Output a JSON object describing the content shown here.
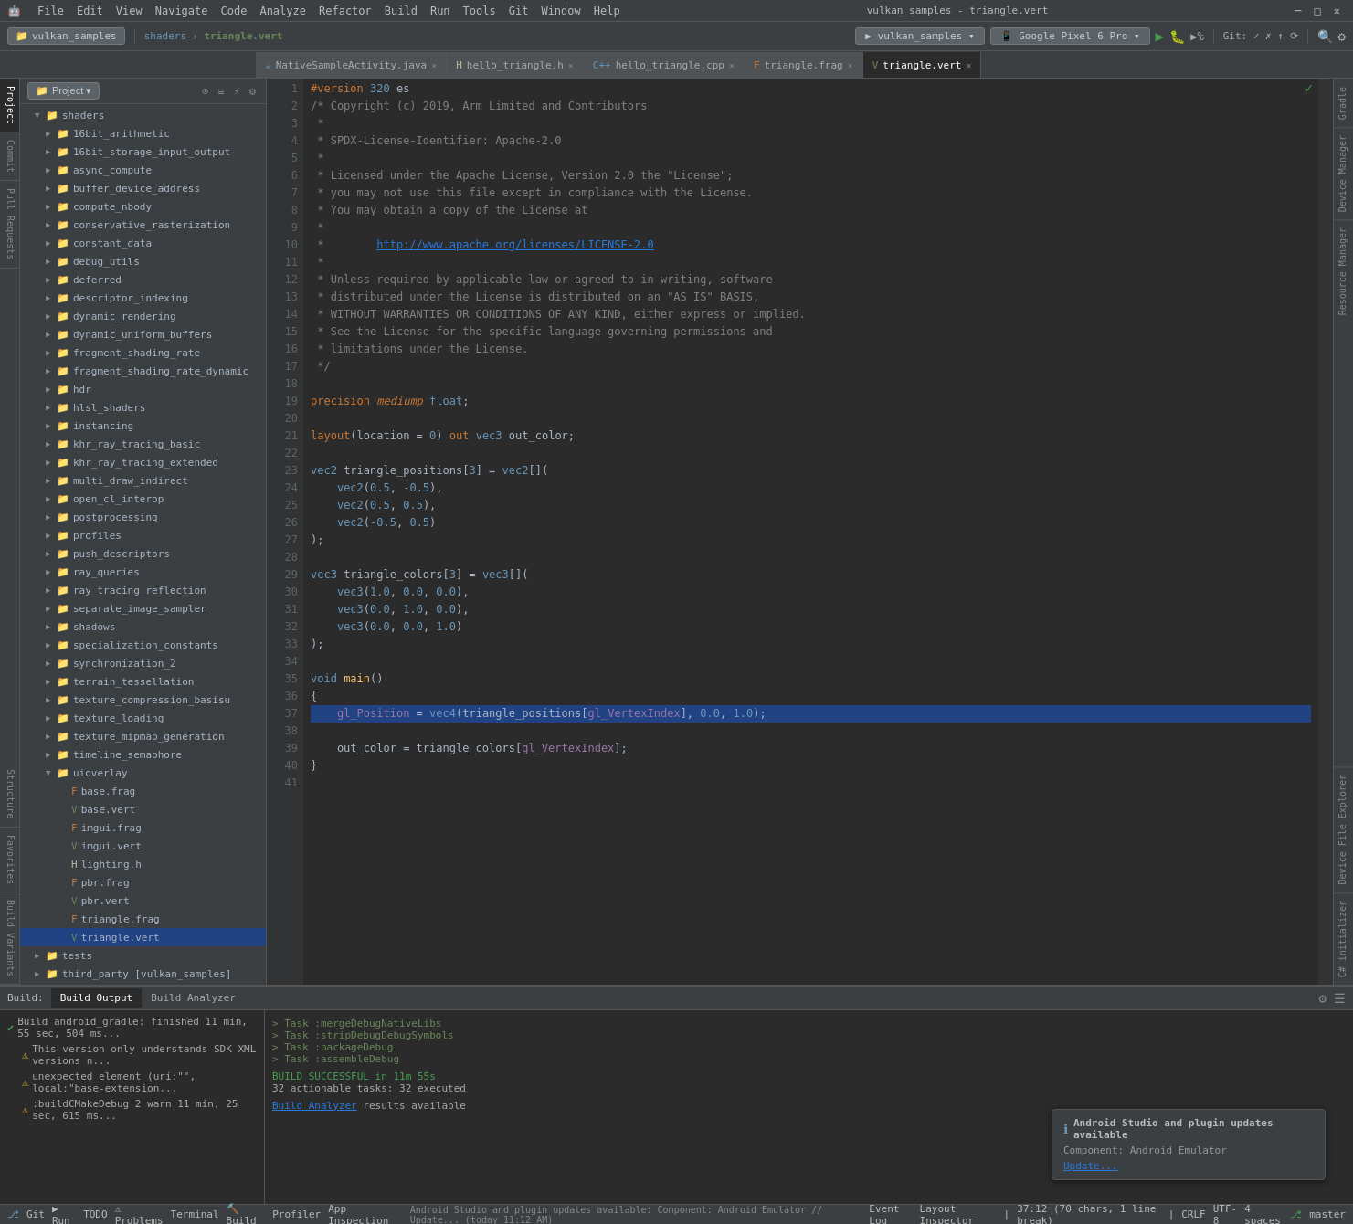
{
  "app": {
    "title": "vulkan_samples - triangle.vert",
    "window_controls": [
      "minimize",
      "maximize",
      "close"
    ]
  },
  "menu": {
    "items": [
      "File",
      "Edit",
      "View",
      "Navigate",
      "Code",
      "Analyze",
      "Refactor",
      "Build",
      "Run",
      "Tools",
      "Git",
      "Window",
      "Help"
    ]
  },
  "toolbar": {
    "project_name": "vulkan_samples",
    "device_name": "Google Pixel 6 Pro",
    "run_config": "vulkan_samples"
  },
  "tabs": [
    {
      "label": "NativeSampleActivity.java",
      "type": "java",
      "active": false
    },
    {
      "label": "hello_triangle.h",
      "type": "h",
      "active": false
    },
    {
      "label": "hello_triangle.cpp",
      "type": "cpp",
      "active": false
    },
    {
      "label": "triangle.frag",
      "type": "frag",
      "active": false
    },
    {
      "label": "triangle.vert",
      "type": "vert",
      "active": true
    }
  ],
  "project_panel": {
    "title": "Project",
    "header_btn": "Project ▾",
    "tree": [
      {
        "label": "shaders",
        "type": "folder",
        "depth": 1,
        "expanded": true
      },
      {
        "label": "16bit_arithmetic",
        "type": "folder",
        "depth": 2
      },
      {
        "label": "16bit_storage_input_output",
        "type": "folder",
        "depth": 2
      },
      {
        "label": "async_compute",
        "type": "folder",
        "depth": 2
      },
      {
        "label": "buffer_device_address",
        "type": "folder",
        "depth": 2
      },
      {
        "label": "compute_nbody",
        "type": "folder",
        "depth": 2
      },
      {
        "label": "conservative_rasterization",
        "type": "folder",
        "depth": 2
      },
      {
        "label": "constant_data",
        "type": "folder",
        "depth": 2
      },
      {
        "label": "debug_utils",
        "type": "folder",
        "depth": 2
      },
      {
        "label": "deferred",
        "type": "folder",
        "depth": 2
      },
      {
        "label": "descriptor_indexing",
        "type": "folder",
        "depth": 2
      },
      {
        "label": "dynamic_rendering",
        "type": "folder",
        "depth": 2
      },
      {
        "label": "dynamic_uniform_buffers",
        "type": "folder",
        "depth": 2
      },
      {
        "label": "fragment_shading_rate",
        "type": "folder",
        "depth": 2
      },
      {
        "label": "fragment_shading_rate_dynamic",
        "type": "folder",
        "depth": 2
      },
      {
        "label": "hdr",
        "type": "folder",
        "depth": 2
      },
      {
        "label": "hlsl_shaders",
        "type": "folder",
        "depth": 2
      },
      {
        "label": "instancing",
        "type": "folder",
        "depth": 2
      },
      {
        "label": "khr_ray_tracing_basic",
        "type": "folder",
        "depth": 2
      },
      {
        "label": "khr_ray_tracing_extended",
        "type": "folder",
        "depth": 2
      },
      {
        "label": "multi_draw_indirect",
        "type": "folder",
        "depth": 2
      },
      {
        "label": "open_cl_interop",
        "type": "folder",
        "depth": 2
      },
      {
        "label": "postprocessing",
        "type": "folder",
        "depth": 2
      },
      {
        "label": "profiles",
        "type": "folder",
        "depth": 2
      },
      {
        "label": "push_descriptors",
        "type": "folder",
        "depth": 2
      },
      {
        "label": "ray_queries",
        "type": "folder",
        "depth": 2
      },
      {
        "label": "ray_tracing_reflection",
        "type": "folder",
        "depth": 2
      },
      {
        "label": "separate_image_sampler",
        "type": "folder",
        "depth": 2
      },
      {
        "label": "shadows",
        "type": "folder",
        "depth": 2
      },
      {
        "label": "specialization_constants",
        "type": "folder",
        "depth": 2
      },
      {
        "label": "synchronization_2",
        "type": "folder",
        "depth": 2
      },
      {
        "label": "terrain_tessellation",
        "type": "folder",
        "depth": 2
      },
      {
        "label": "texture_compression_basisu",
        "type": "folder",
        "depth": 2
      },
      {
        "label": "texture_loading",
        "type": "folder",
        "depth": 2
      },
      {
        "label": "texture_mipmap_generation",
        "type": "folder",
        "depth": 2
      },
      {
        "label": "timeline_semaphore",
        "type": "folder",
        "depth": 2
      },
      {
        "label": "uioverlay",
        "type": "folder",
        "depth": 2,
        "expanded": true
      },
      {
        "label": "base.frag",
        "type": "frag",
        "depth": 3
      },
      {
        "label": "base.vert",
        "type": "vert",
        "depth": 3
      },
      {
        "label": "imgui.frag",
        "type": "frag",
        "depth": 3
      },
      {
        "label": "imgui.vert",
        "type": "vert",
        "depth": 3
      },
      {
        "label": "lighting.h",
        "type": "h",
        "depth": 3
      },
      {
        "label": "pbr.frag",
        "type": "frag",
        "depth": 3
      },
      {
        "label": "pbr.vert",
        "type": "vert",
        "depth": 3
      },
      {
        "label": "triangle.frag",
        "type": "frag",
        "depth": 3
      },
      {
        "label": "triangle.vert",
        "type": "vert",
        "depth": 3,
        "selected": true
      },
      {
        "label": "tests",
        "type": "folder",
        "depth": 1
      },
      {
        "label": "third_party [vulkan_samples]",
        "type": "folder",
        "depth": 1
      }
    ]
  },
  "editor": {
    "filename": "triangle.vert",
    "lines": [
      {
        "num": 1,
        "content": "#version 320 es",
        "tokens": [
          {
            "text": "#version 320 es",
            "class": ""
          }
        ]
      },
      {
        "num": 2,
        "content": "/* Copyright (c) 2019, Arm Limited and Contributors"
      },
      {
        "num": 3,
        "content": " *"
      },
      {
        "num": 4,
        "content": " * SPDX-License-Identifier: Apache-2.0"
      },
      {
        "num": 5,
        "content": " *"
      },
      {
        "num": 6,
        "content": " * Licensed under the Apache License, Version 2.0 the \"License\";"
      },
      {
        "num": 7,
        "content": " * you may not use this file except in compliance with the License."
      },
      {
        "num": 8,
        "content": " * You may obtain a copy of the License at"
      },
      {
        "num": 9,
        "content": " *"
      },
      {
        "num": 10,
        "content": " *        http://www.apache.org/licenses/LICENSE-2.0",
        "url": true
      },
      {
        "num": 11,
        "content": " *"
      },
      {
        "num": 12,
        "content": " * Unless required by applicable law or agreed to in writing, software"
      },
      {
        "num": 13,
        "content": " * distributed under the License is distributed on an \"AS IS\" BASIS,"
      },
      {
        "num": 14,
        "content": " * WITHOUT WARRANTIES OR CONDITIONS OF ANY KIND, either express or implied."
      },
      {
        "num": 15,
        "content": " * See the License for the specific language governing permissions and"
      },
      {
        "num": 16,
        "content": " * limitations under the License."
      },
      {
        "num": 17,
        "content": " */"
      },
      {
        "num": 18,
        "content": ""
      },
      {
        "num": 19,
        "content": "precision mediump float;",
        "has_keyword": true
      },
      {
        "num": 20,
        "content": ""
      },
      {
        "num": 21,
        "content": "layout(location = 0) out vec3 out_color;",
        "has_keyword": true
      },
      {
        "num": 22,
        "content": ""
      },
      {
        "num": 23,
        "content": "vec2 triangle_positions[3] = vec2[]("
      },
      {
        "num": 24,
        "content": "    vec2(0.5, -0.5),"
      },
      {
        "num": 25,
        "content": "    vec2(0.5, 0.5),"
      },
      {
        "num": 26,
        "content": "    vec2(-0.5, 0.5)"
      },
      {
        "num": 27,
        "content": ");"
      },
      {
        "num": 28,
        "content": ""
      },
      {
        "num": 29,
        "content": "vec3 triangle_colors[3] = vec3[]("
      },
      {
        "num": 30,
        "content": "    vec3(1.0, 0.0, 0.0),"
      },
      {
        "num": 31,
        "content": "    vec3(0.0, 1.0, 0.0),"
      },
      {
        "num": 32,
        "content": "    vec3(0.0, 0.0, 1.0)"
      },
      {
        "num": 33,
        "content": ");"
      },
      {
        "num": 34,
        "content": ""
      },
      {
        "num": 35,
        "content": "void main()"
      },
      {
        "num": 36,
        "content": "{"
      },
      {
        "num": 37,
        "content": "    gl_Position = vec4(triangle_positions[gl_VertexIndex], 0.0, 1.0);",
        "highlighted": true
      },
      {
        "num": 38,
        "content": ""
      },
      {
        "num": 39,
        "content": "    out_color = triangle_colors[gl_VertexIndex];"
      },
      {
        "num": 40,
        "content": "}"
      },
      {
        "num": 41,
        "content": ""
      }
    ]
  },
  "bottom_panel": {
    "build_label": "Build:",
    "tabs": [
      "Build Output",
      "Build Analyzer"
    ],
    "active_tab": "Build Output",
    "build_items": [
      {
        "type": "success",
        "label": "Build android_gradle: finished 11 min, 55 sec, 504 ms..."
      },
      {
        "type": "warn",
        "label": "This version only understands SDK XML versions n..."
      },
      {
        "type": "warn",
        "label": "unexpected element (uri:\"\", local:\"base-extension..."
      },
      {
        "type": "warn",
        "label": ":buildCMakeDebug 2 warn 11 min, 25 sec, 615 ms..."
      }
    ],
    "output_lines": [
      "> Task :mergeDebugNativeLibs",
      "> Task :stripDebugDebugSymbols",
      "> Task :packageDebug",
      "> Task :assembleDebug",
      "",
      "BUILD SUCCESSFUL in 11m 55s",
      "32 actionable tasks: 32 executed",
      "",
      "Build Analyzer results available"
    ]
  },
  "notification": {
    "title": "Android Studio and plugin updates available",
    "subtitle": "Component: Android Emulator",
    "link": "Update..."
  },
  "status_bar": {
    "git_branch": "Git",
    "run_label": "Run",
    "todo_label": "TODO",
    "problems_label": "Problems",
    "terminal_label": "Terminal",
    "build_label": "Build",
    "profiler_label": "Profiler",
    "app_inspection_label": "App Inspection",
    "event_log_label": "Event Log",
    "layout_inspector_label": "Layout Inspector",
    "position": "37:12 (70 chars, 1 line break)",
    "encoding": "CRLF",
    "charset": "UTF-8",
    "indent": "4 spaces",
    "branch": "master",
    "status_text": "Android Studio and plugin updates available: Component: Android Emulator // Update... (today 11:12 AM)"
  },
  "right_tabs": [
    "Gradle",
    "Device Manager",
    "Resource Manager",
    "Device File Explorer",
    "C# initializer"
  ],
  "left_vtabs": [
    "Project",
    "Commit",
    "Pull Requests",
    "Structure",
    "Favorites",
    "Build Variants"
  ]
}
